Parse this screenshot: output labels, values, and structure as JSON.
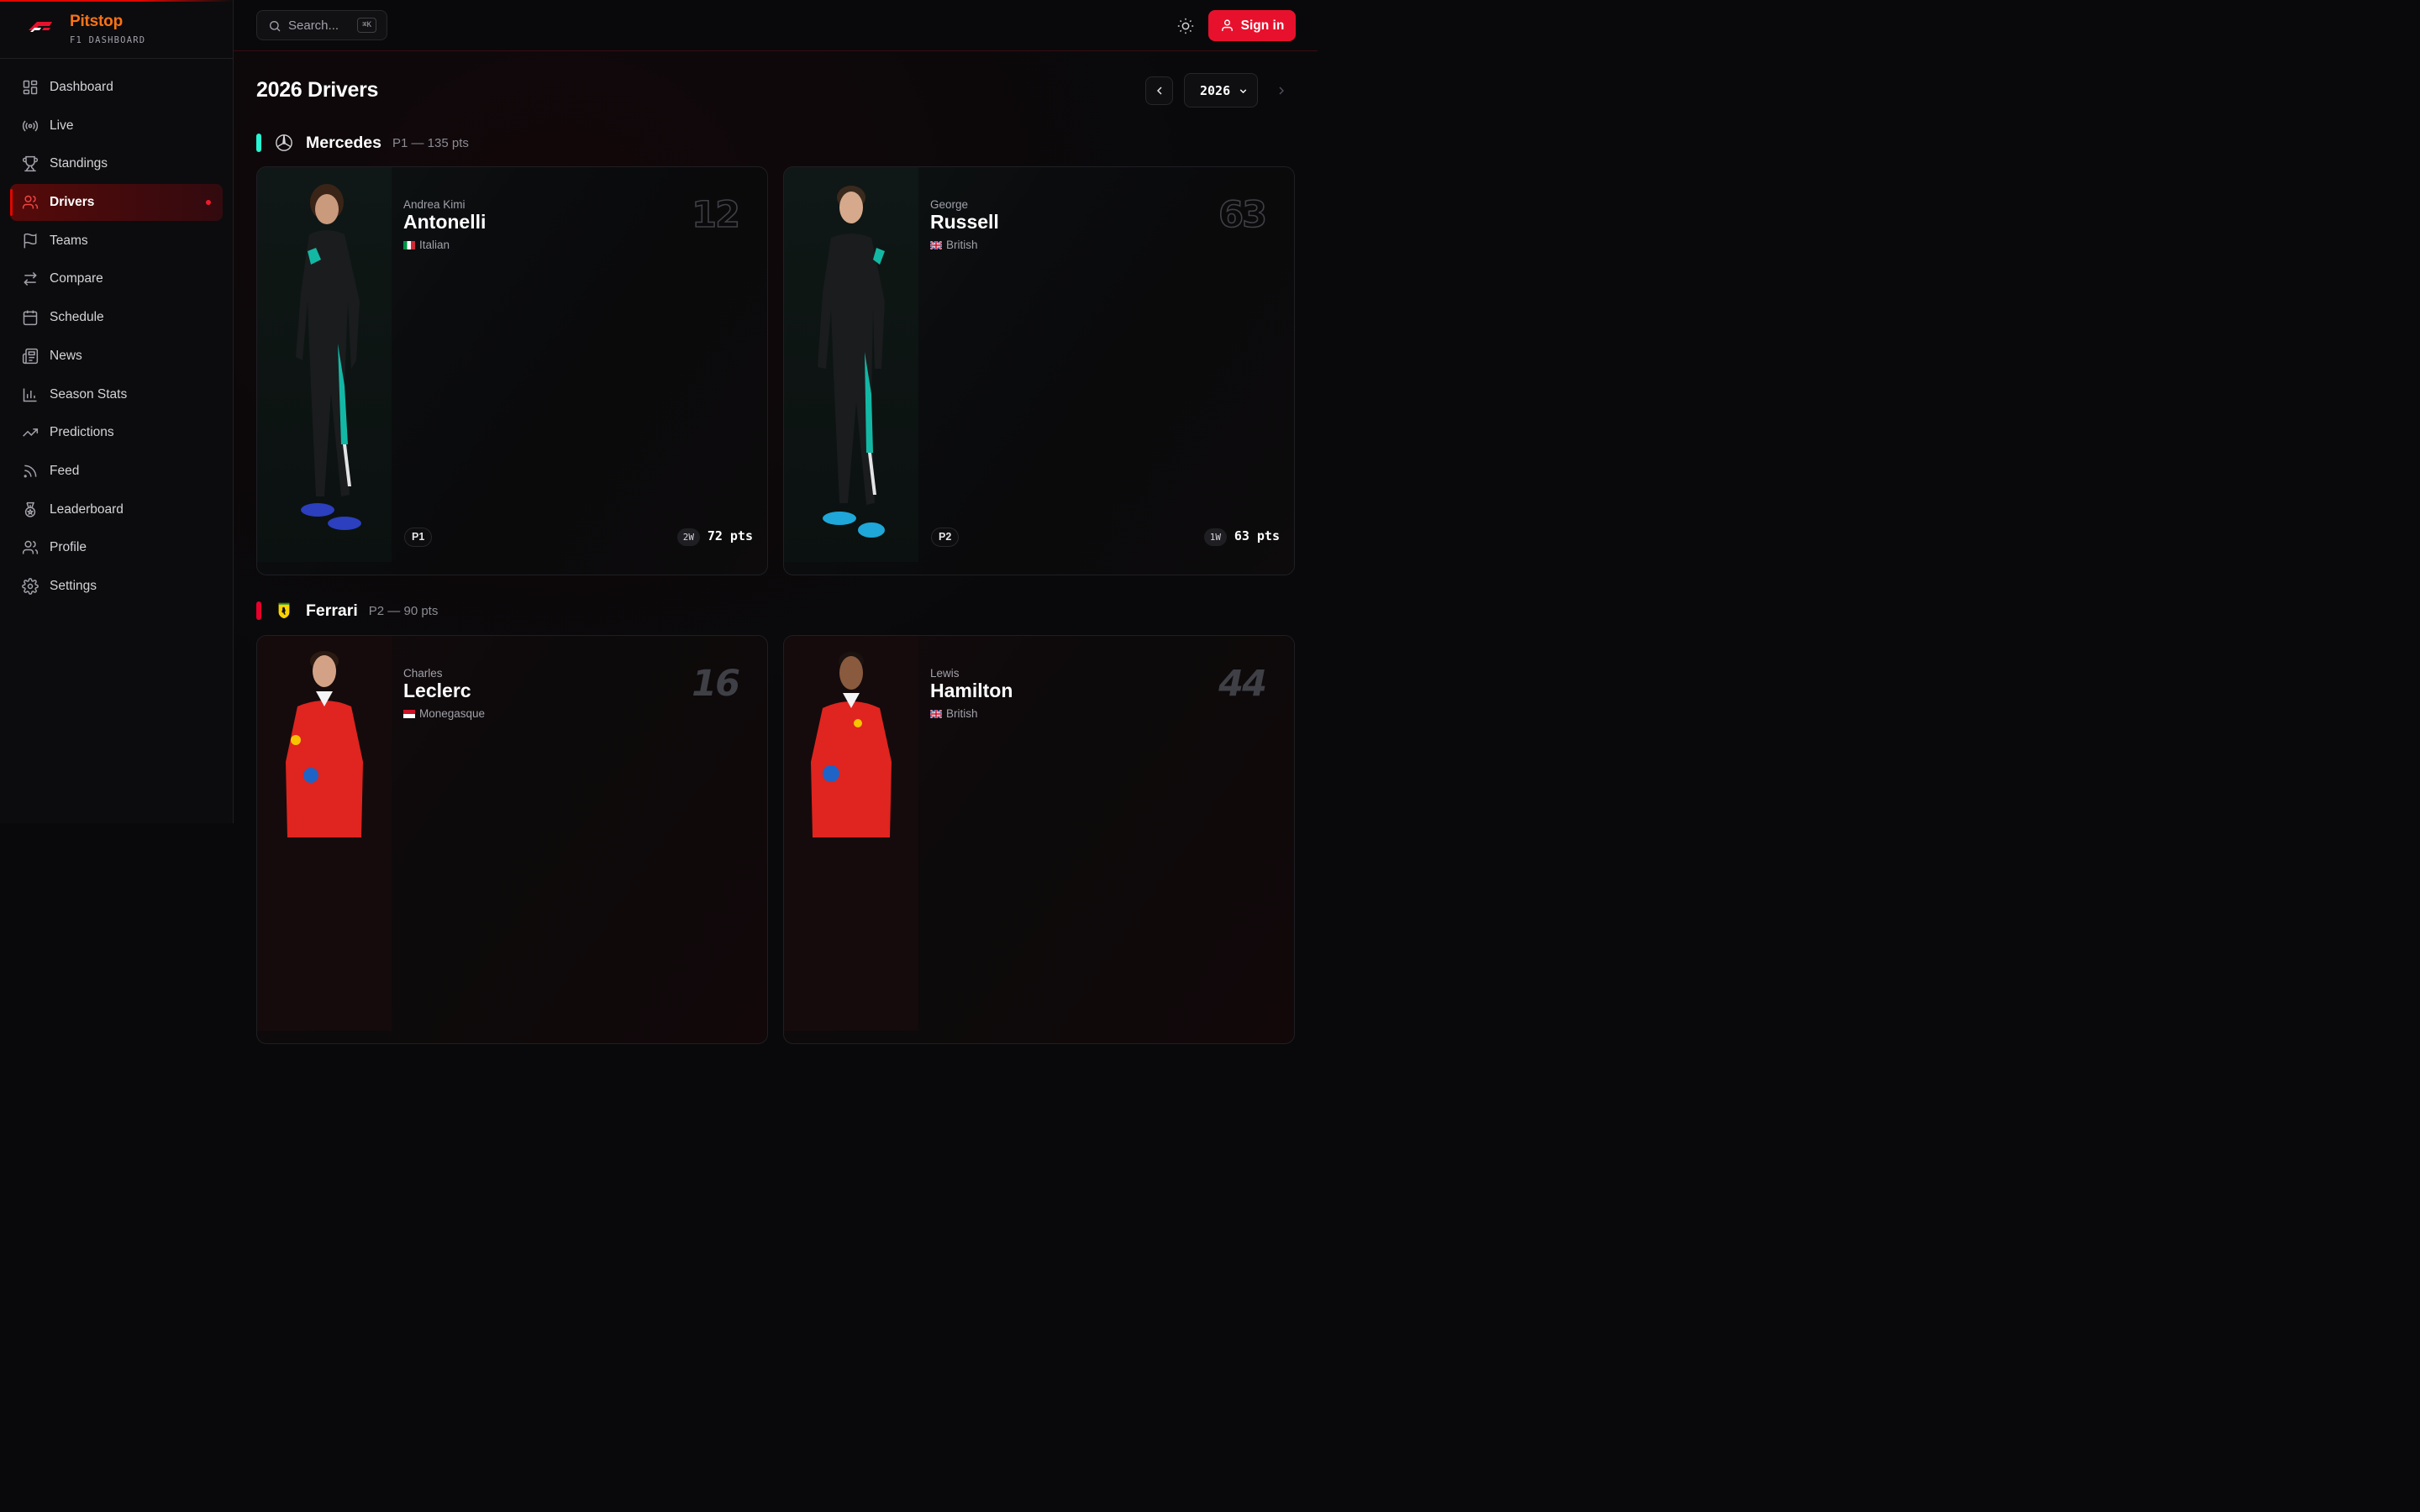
{
  "brand": {
    "name": "Pitstop",
    "subtitle": "F1 DASHBOARD"
  },
  "sidebar": {
    "items": [
      {
        "label": "Dashboard",
        "icon": "grid-icon"
      },
      {
        "label": "Live",
        "icon": "broadcast-icon"
      },
      {
        "label": "Standings",
        "icon": "trophy-icon"
      },
      {
        "label": "Drivers",
        "icon": "users-icon",
        "active": true
      },
      {
        "label": "Teams",
        "icon": "flag-icon"
      },
      {
        "label": "Compare",
        "icon": "arrows-swap-icon"
      },
      {
        "label": "Schedule",
        "icon": "calendar-icon"
      },
      {
        "label": "News",
        "icon": "newspaper-icon"
      },
      {
        "label": "Season Stats",
        "icon": "bar-chart-icon"
      },
      {
        "label": "Predictions",
        "icon": "trending-up-icon"
      },
      {
        "label": "Feed",
        "icon": "rss-icon"
      },
      {
        "label": "Leaderboard",
        "icon": "medal-icon"
      },
      {
        "label": "Profile",
        "icon": "user-icon"
      },
      {
        "label": "Settings",
        "icon": "gear-icon"
      }
    ]
  },
  "header": {
    "search_placeholder": "Search...",
    "search_shortcut": "⌘K",
    "signin_label": "Sign in"
  },
  "page": {
    "title": "2026 Drivers",
    "year": "2026"
  },
  "teams": [
    {
      "name": "Mercedes",
      "stat": "P1 — 135 pts",
      "color": "#27f4d2",
      "drivers": [
        {
          "first": "Andrea Kimi",
          "last": "Antonelli",
          "nationality": "Italian",
          "number": "12",
          "position": "P1",
          "wins": "2W",
          "points": "72 pts"
        },
        {
          "first": "George",
          "last": "Russell",
          "nationality": "British",
          "number": "63",
          "position": "P2",
          "wins": "1W",
          "points": "63 pts"
        }
      ]
    },
    {
      "name": "Ferrari",
      "stat": "P2 — 90 pts",
      "color": "#e8002d",
      "drivers": [
        {
          "first": "Charles",
          "last": "Leclerc",
          "nationality": "Monegasque",
          "number": "16"
        },
        {
          "first": "Lewis",
          "last": "Hamilton",
          "nationality": "British",
          "number": "44"
        }
      ]
    }
  ],
  "colors": {
    "accent": "#e8112d",
    "brand": "#f97316",
    "mercedes": "#27f4d2",
    "ferrari": "#e8002d"
  }
}
